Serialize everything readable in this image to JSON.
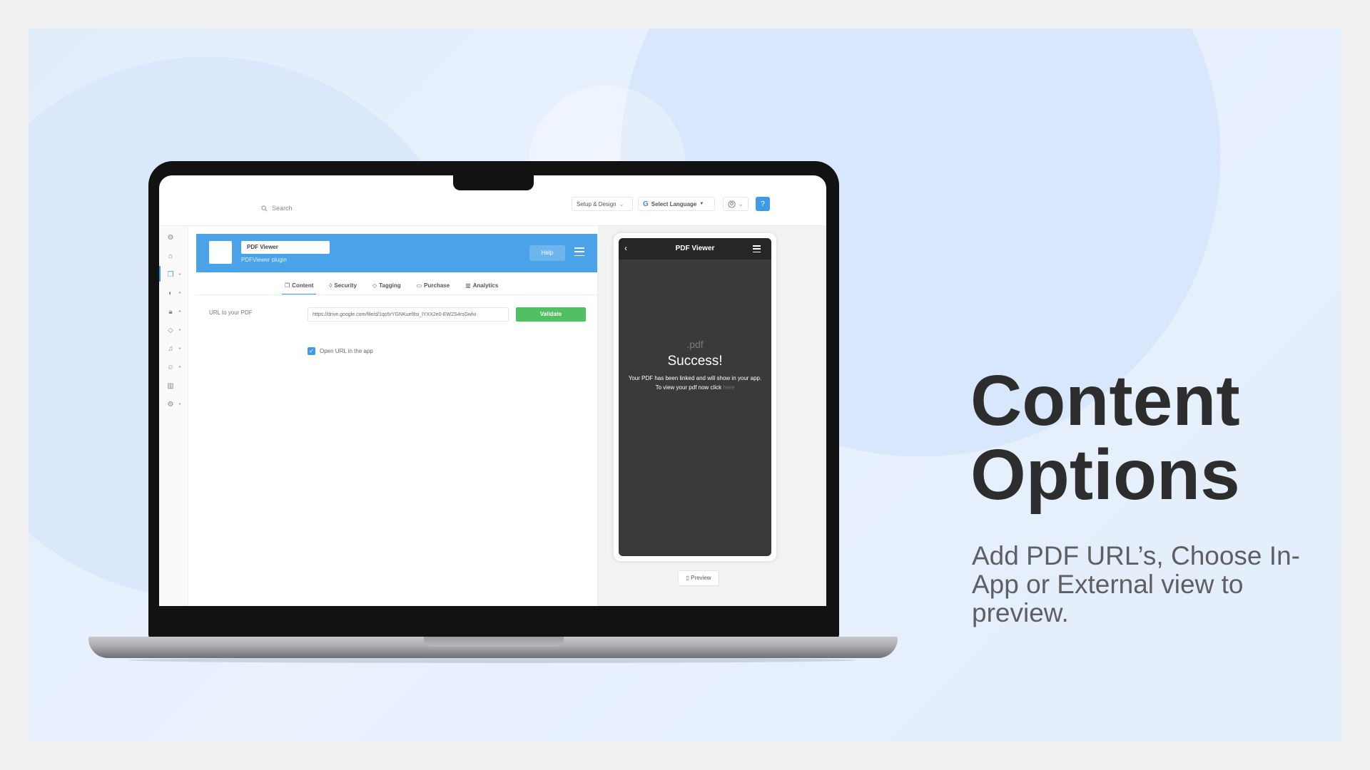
{
  "headline": {
    "line1": "Content",
    "line2": "Options"
  },
  "subline": "Add PDF URL’s, Choose In-App or External view to preview.",
  "topbar": {
    "search_placeholder": "Search",
    "setup_design": "Setup & Design",
    "select_language": "Select Language",
    "language_caret": "▼"
  },
  "plugin": {
    "name": "PDF Viewer",
    "subtitle": "PDFViewer plugin",
    "help_label": "Help",
    "tabs": [
      {
        "label": "Content",
        "icon": "file-icon"
      },
      {
        "label": "Security",
        "icon": "shield-icon"
      },
      {
        "label": "Tagging",
        "icon": "tag-icon"
      },
      {
        "label": "Purchase",
        "icon": "card-icon"
      },
      {
        "label": "Analytics",
        "icon": "bar-chart-icon"
      }
    ],
    "url_label": "URL to your PDF",
    "url_value": "https://drive.google.com/file/d/1qo5rYGNKuef8si_lYXX2e0-EW2S4rsGwlvi",
    "validate_label": "Validate",
    "open_in_app_label": "Open URL in the app",
    "open_in_app_checked": true
  },
  "phone": {
    "title": "PDF Viewer",
    "pdf_mark": ".pdf",
    "success": "Success!",
    "message1": "Your PDF has been linked and will show in your app.",
    "message2": "To view your pdf now click",
    "here": "here"
  },
  "preview_label": "Preview",
  "colors": {
    "accent": "#4aa3e8",
    "validate": "#4fc163",
    "phone_dark": "#3a3a3a"
  }
}
